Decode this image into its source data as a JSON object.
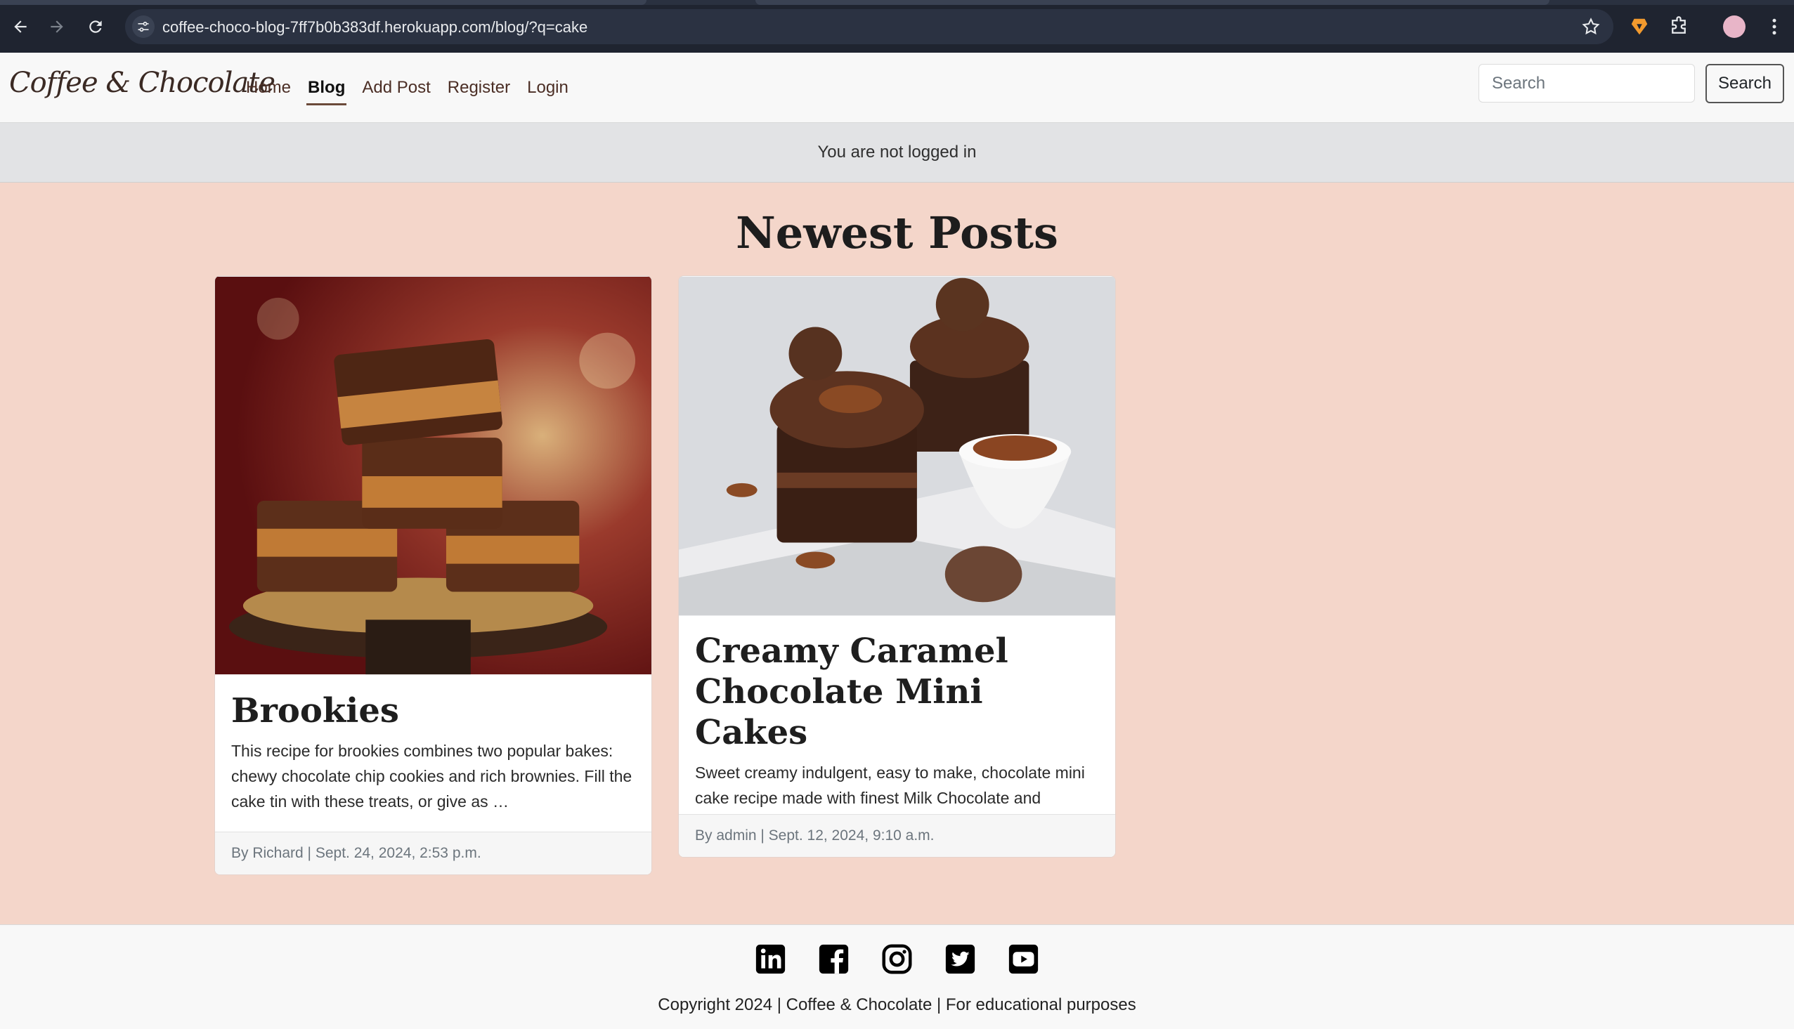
{
  "browser": {
    "url": "coffee-choco-blog-7ff7b0b383df.herokuapp.com/blog/?q=cake"
  },
  "navbar": {
    "brand": "Coffee & Chocolate",
    "links": [
      {
        "label": "Home",
        "active": false
      },
      {
        "label": "Blog",
        "active": true
      },
      {
        "label": "Add Post",
        "active": false
      },
      {
        "label": "Register",
        "active": false
      },
      {
        "label": "Login",
        "active": false
      }
    ],
    "search_placeholder": "Search",
    "search_button": "Search"
  },
  "status": {
    "login_message": "You are not logged in"
  },
  "main": {
    "heading": "Newest Posts",
    "posts": [
      {
        "title": "Brookies",
        "excerpt": "This recipe for brookies combines two popular bakes: chewy chocolate chip cookies and rich brownies. Fill the cake tin with these treats, or give as …",
        "meta": "By Richard | Sept. 24, 2024, 2:53 p.m.",
        "image_icon": "brownies-photo"
      },
      {
        "title": "Creamy Caramel Chocolate Mini Cakes",
        "excerpt": "Sweet creamy indulgent, easy to make, chocolate mini cake recipe made with finest Milk Chocolate and Creamy Caramels with Sea Salt.",
        "meta": "By admin | Sept. 12, 2024, 9:10 a.m.",
        "image_icon": "mini-cakes-photo"
      }
    ]
  },
  "footer": {
    "socials": [
      "linkedin-icon",
      "facebook-icon",
      "instagram-icon",
      "twitter-icon",
      "youtube-icon"
    ],
    "copyright": "Copyright 2024 | Coffee & Chocolate | For educational purposes"
  },
  "colors": {
    "page_bg": "#f4d6ca",
    "nav_text": "#4b2e25",
    "brand_dark": "#3b2a24"
  }
}
